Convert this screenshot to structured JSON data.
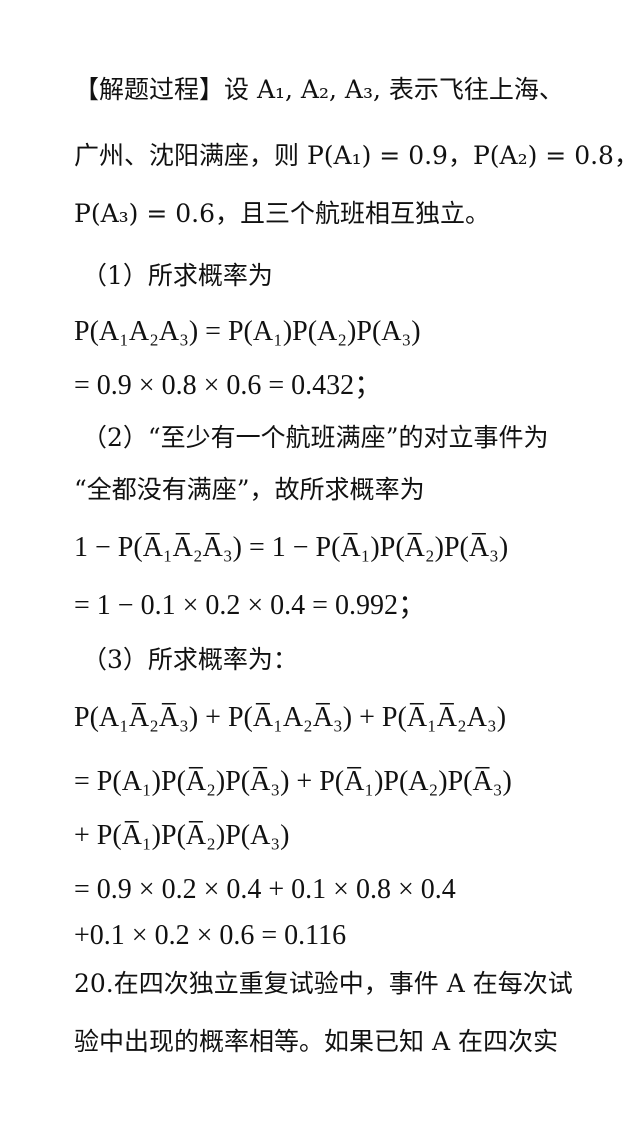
{
  "document": {
    "lines": [
      "【解题过程】设 A₁, A₂, A₃, 表示飞往上海、",
      "广州、沈阳满座，则 P(A₁) = 0.9，P(A₂) = 0.8，",
      "P(A₃) = 0.6，且三个航班相互独立。",
      "（1）所求概率为",
      "P(A₁A₂A₃) = P(A₁)P(A₂)P(A₃)",
      "= 0.9 × 0.8 × 0.6 = 0.432；",
      "（2）“至少有一个航班满座”的对立事件为",
      "“全都没有满座”，故所求概率为",
      "1 − P(A̅₁A̅₂A̅₃) = 1 − P(A̅₁)P(A̅₂)P(A̅₃)",
      "= 1 − 0.1 × 0.2 × 0.4 = 0.992；",
      "（3）所求概率为：",
      "P(A₁A̅₂A̅₃) + P(A̅₁A₂A̅₃) + P(A̅₁A̅₂A₃)",
      "= P(A₁)P(A̅₂)P(A̅₃) + P(A̅₁)P(A₂)P(A̅₃)",
      "+ P(A̅₁)P(A̅₂)P(A₃)",
      "= 0.9 × 0.2 × 0.4 + 0.1 × 0.8 × 0.4",
      "+0.1 × 0.2 × 0.6 = 0.116",
      "20.在四次独立重复试验中，事件 A 在每次试",
      "验中出现的概率相等。如果已知 A 在四次实"
    ]
  }
}
